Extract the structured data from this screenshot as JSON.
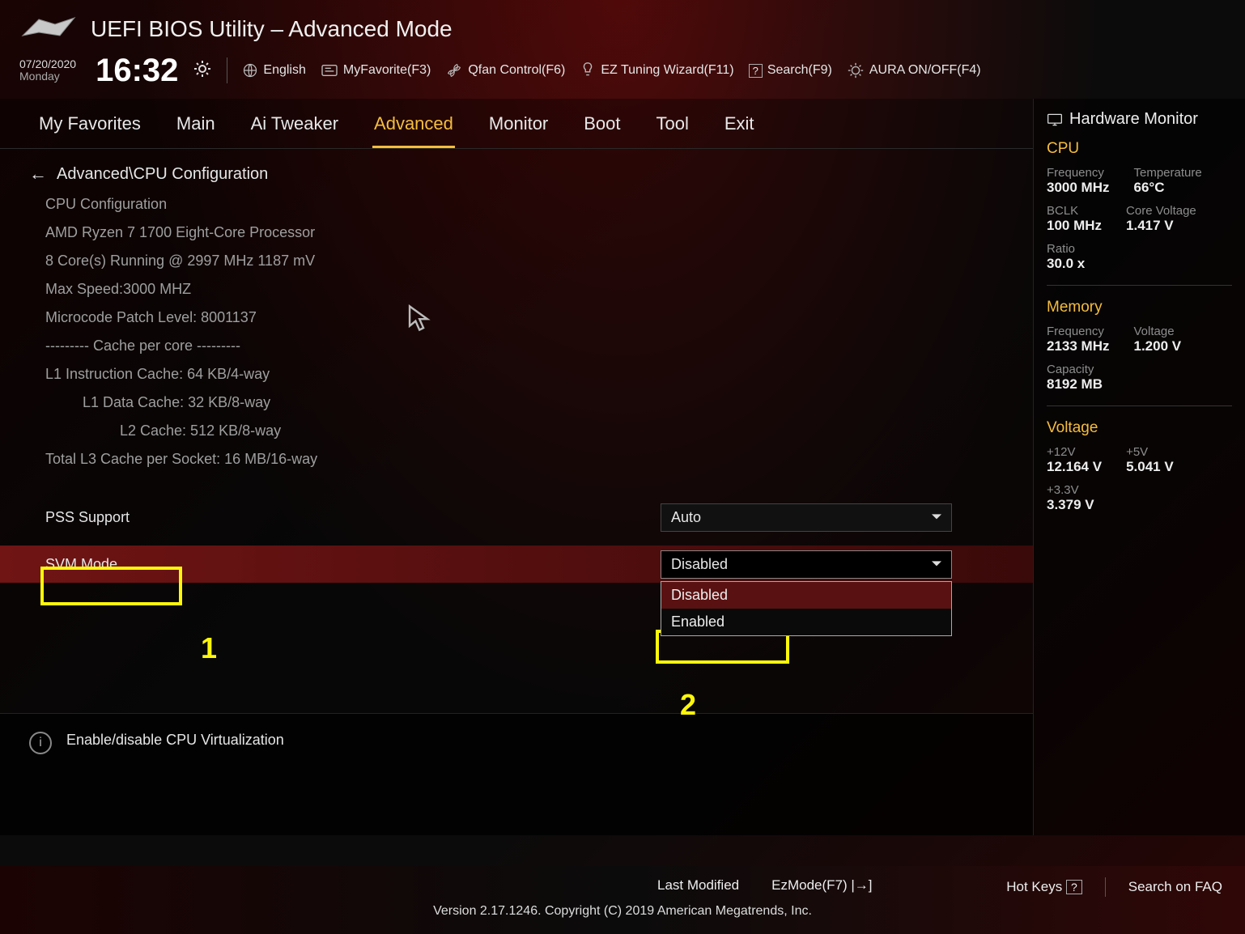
{
  "header": {
    "title": "UEFI BIOS Utility – Advanced Mode",
    "date": "07/20/2020",
    "day": "Monday",
    "time": "16:32",
    "buttons": {
      "lang": "English",
      "fav": "MyFavorite(F3)",
      "qfan": "Qfan Control(F6)",
      "ez": "EZ Tuning Wizard(F11)",
      "search": "Search(F9)",
      "aura": "AURA ON/OFF(F4)"
    }
  },
  "tabs": [
    "My Favorites",
    "Main",
    "Ai Tweaker",
    "Advanced",
    "Monitor",
    "Boot",
    "Tool",
    "Exit"
  ],
  "tabs_active_index": 3,
  "breadcrumb": "Advanced\\CPU Configuration",
  "cpu_info": {
    "section": "CPU Configuration",
    "name": "AMD Ryzen 7 1700 Eight-Core Processor",
    "cores": "8 Core(s) Running @ 2997 MHz  1187 mV",
    "max": "Max Speed:3000 MHZ",
    "micro": "Microcode Patch Level: 8001137",
    "cache_hdr": "--------- Cache per core ---------",
    "l1i": "L1 Instruction Cache: 64 KB/4-way",
    "l1d": "L1 Data Cache: 32 KB/8-way",
    "l2": "L2 Cache: 512 KB/8-way",
    "l3": "Total L3 Cache per Socket: 16 MB/16-way"
  },
  "settings": {
    "pss": {
      "label": "PSS Support",
      "value": "Auto"
    },
    "svm": {
      "label": "SVM Mode",
      "value": "Disabled",
      "options": [
        "Disabled",
        "Enabled"
      ],
      "selected_option_index": 0
    }
  },
  "help_text": "Enable/disable CPU Virtualization",
  "sidebar": {
    "title": "Hardware Monitor",
    "cpu": {
      "title": "CPU",
      "freq_l": "Frequency",
      "freq_v": "3000 MHz",
      "temp_l": "Temperature",
      "temp_v": "66°C",
      "bclk_l": "BCLK",
      "bclk_v": "100 MHz",
      "cv_l": "Core Voltage",
      "cv_v": "1.417 V",
      "ratio_l": "Ratio",
      "ratio_v": "30.0 x"
    },
    "mem": {
      "title": "Memory",
      "freq_l": "Frequency",
      "freq_v": "2133 MHz",
      "volt_l": "Voltage",
      "volt_v": "1.200 V",
      "cap_l": "Capacity",
      "cap_v": "8192 MB"
    },
    "volt": {
      "title": "Voltage",
      "v12_l": "+12V",
      "v12_v": "12.164 V",
      "v5_l": "+5V",
      "v5_v": "5.041 V",
      "v33_l": "+3.3V",
      "v33_v": "3.379 V"
    }
  },
  "footer": {
    "last_modified": "Last Modified",
    "ezmode": "EzMode(F7)",
    "hotkeys": "Hot Keys",
    "faq": "Search on FAQ",
    "copyright": "Version 2.17.1246. Copyright (C) 2019 American Megatrends, Inc."
  },
  "annotations": {
    "one": "1",
    "two": "2"
  }
}
